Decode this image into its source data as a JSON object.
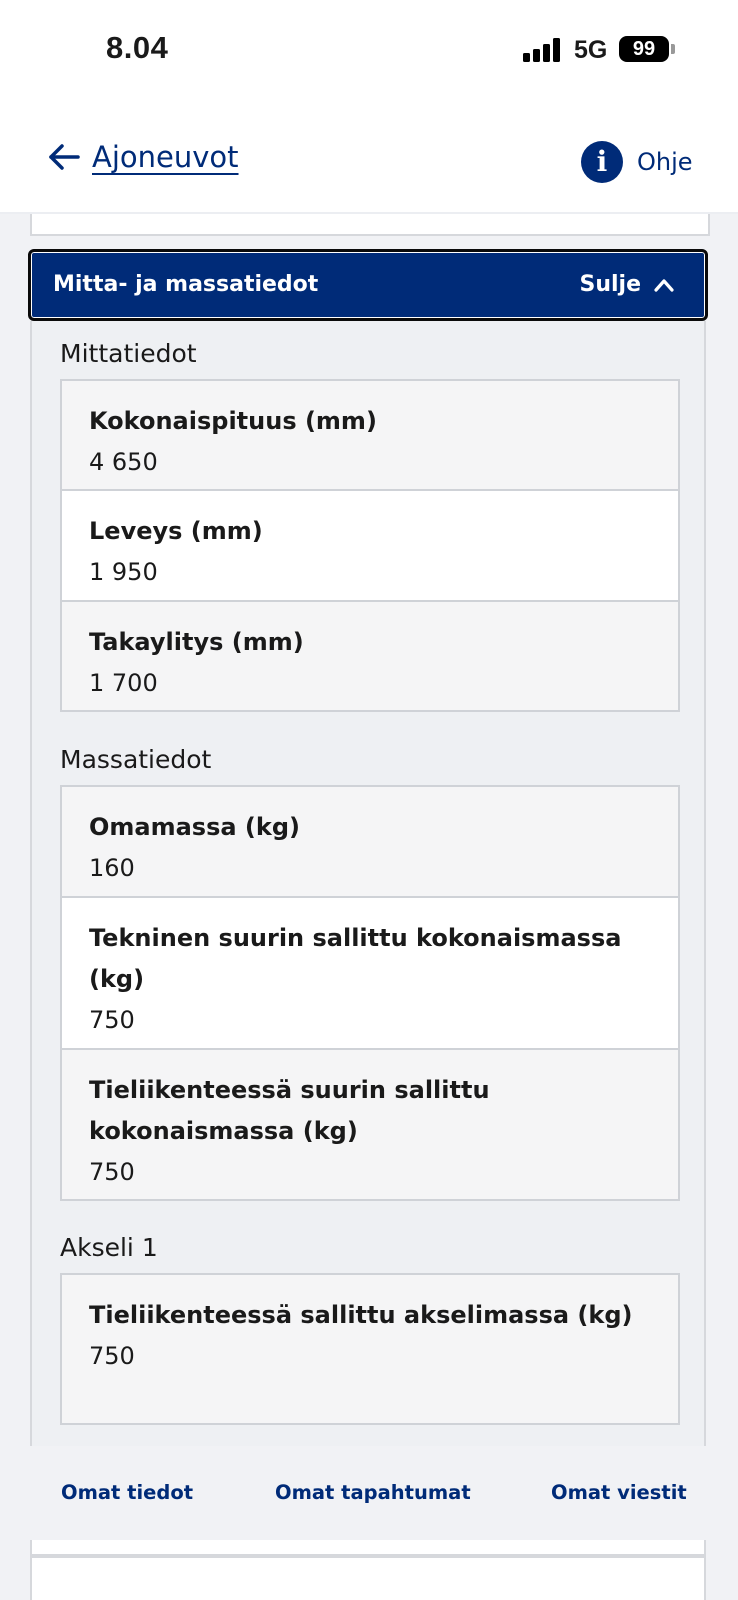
{
  "status_bar": {
    "time": "8.04",
    "network": "5G",
    "battery": "99"
  },
  "header": {
    "back_label": "Ajoneuvot",
    "help_label": "Ohje"
  },
  "accordion": {
    "title": "Mitta- ja massatiedot",
    "toggle_label": "Sulje",
    "sections": [
      {
        "title": "Mittatiedot",
        "fields": [
          {
            "label": "Kokonaispituus (mm)",
            "value": "4 650"
          },
          {
            "label": "Leveys (mm)",
            "value": "1 950"
          },
          {
            "label": "Takaylitys (mm)",
            "value": "1 700"
          }
        ]
      },
      {
        "title": "Massatiedot",
        "fields": [
          {
            "label": "Omamassa (kg)",
            "value": "160"
          },
          {
            "label": "Tekninen suurin sallittu kokonaismassa (kg)",
            "value": "750"
          },
          {
            "label": "Tieliikenteessä suurin sallittu kokonaismassa (kg)",
            "value": "750"
          }
        ]
      },
      {
        "title": "Akseli 1",
        "fields": [
          {
            "label": "Tieliikenteessä sallittu akselimassa (kg)",
            "value": "750"
          }
        ]
      }
    ]
  },
  "tab_bar": {
    "items": [
      {
        "label": "Omat tiedot"
      },
      {
        "label": "Omat tapahtumat"
      },
      {
        "label": "Omat viestit"
      }
    ]
  },
  "colors": {
    "brand": "#002b78",
    "page_background": "#f1f2f5",
    "field_background": "#f5f5f6",
    "field_alt_background": "#ffffff",
    "border": "#cfd2d7"
  },
  "icons": {
    "back": "arrow-left-icon",
    "help": "info-icon",
    "toggle": "chevron-up-icon",
    "signal": "cellular-signal-icon",
    "battery": "battery-icon"
  }
}
